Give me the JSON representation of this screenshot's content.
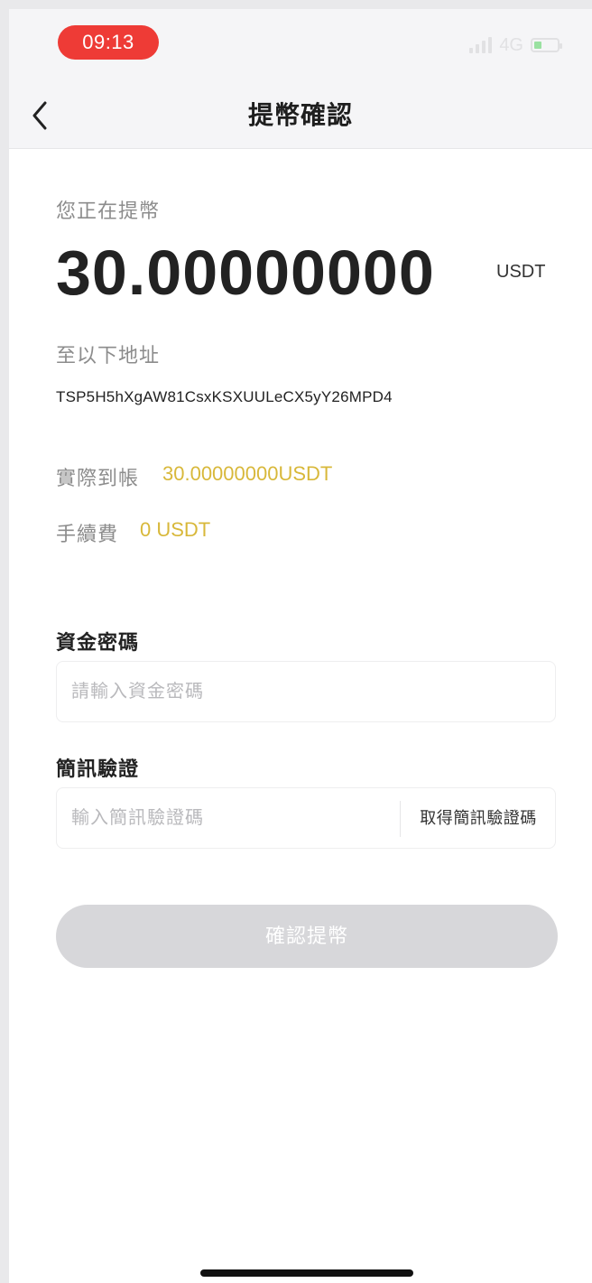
{
  "status_bar": {
    "time": "09:13",
    "network": "4G"
  },
  "header": {
    "title": "提幣確認"
  },
  "withdraw": {
    "intro_label": "您正在提幣",
    "amount": "30.00000000",
    "unit": "USDT",
    "address_label": "至以下地址",
    "address": "TSP5H5hXgAW81CsxKSXUULeCX5yY26MPD4",
    "received_label": "實際到帳",
    "received_value": "30.00000000USDT",
    "fee_label": "手續費",
    "fee_value": "0 USDT"
  },
  "fund_password": {
    "title": "資金密碼",
    "placeholder": "請輸入資金密碼",
    "value": ""
  },
  "sms": {
    "title": "簡訊驗證",
    "placeholder": "輸入簡訊驗證碼",
    "value": "",
    "get_code_label": "取得簡訊驗證碼"
  },
  "confirm_button": {
    "label": "確認提幣"
  },
  "colors": {
    "accent_gold": "#d8b83a",
    "time_pill": "#ee3b36",
    "button_disabled": "#d7d7da"
  }
}
